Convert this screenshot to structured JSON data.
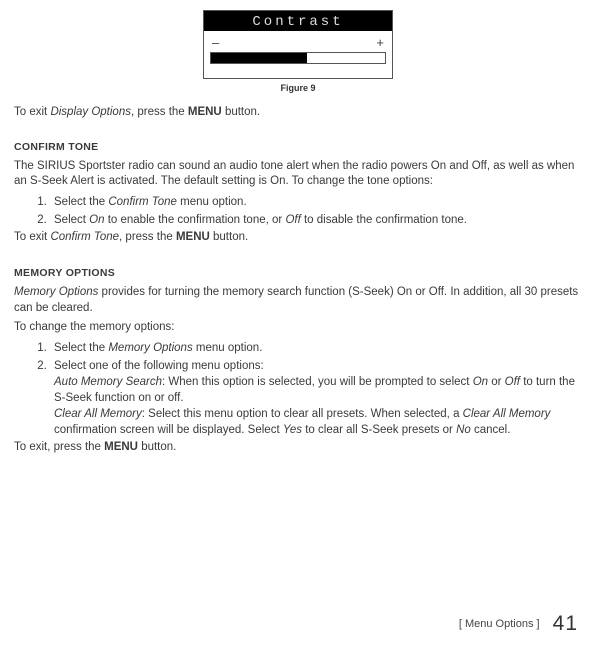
{
  "lcd": {
    "title": "Contrast",
    "minus": "–",
    "plus": "+"
  },
  "figure_caption": "Figure 9",
  "exit_display": {
    "pre": "To exit ",
    "italic": "Display Options",
    "mid": ", press the ",
    "bold": "MENU",
    "post": " button."
  },
  "confirm": {
    "heading": "CONFIRM TONE",
    "intro": "The SIRIUS Sportster radio can sound an audio tone alert when the radio powers On and Off, as well as when an S-Seek Alert is activated. The default setting is On. To change the tone options:",
    "step1": {
      "pre": "Select the ",
      "italic": "Confirm Tone",
      "post": " menu option."
    },
    "step2": {
      "pre": "Select ",
      "i1": "On",
      "mid": " to enable the confirmation tone, or ",
      "i2": "Off",
      "post": " to disable the confirmation tone."
    },
    "exit": {
      "pre": "To exit ",
      "italic": "Confirm Tone",
      "mid": ", press the ",
      "bold": "MENU",
      "post": " button."
    }
  },
  "memory": {
    "heading": "MEMORY OPTIONS",
    "intro": {
      "i": "Memory Options",
      "rest": " provides for turning the memory search function (S-Seek) On or Off. In addition, all 30 presets can be cleared."
    },
    "lead": "To change the memory options:",
    "step1": {
      "pre": "Select the ",
      "italic": "Memory Options",
      "post": " menu option."
    },
    "step2_lead": "Select one of the following menu options:",
    "step2_a": {
      "i1": "Auto Memory Search",
      "t1": ": When this option is selected, you will be prompted to select ",
      "i2": "On",
      "t2": " or ",
      "i3": "Off",
      "t3": " to turn the S-Seek function on or off."
    },
    "step2_b": {
      "i1": "Clear All Memory",
      "t1": ": Select this menu option to clear all presets. When selected, a ",
      "i2": "Clear All Memory",
      "t2": " confirmation screen will be displayed. Select ",
      "i3": "Yes",
      "t3": " to clear all S-Seek presets or ",
      "i4": "No",
      "t4": " cancel."
    },
    "exit": {
      "pre": "To exit, press the ",
      "bold": "MENU",
      "post": " button."
    }
  },
  "footer": {
    "section": "[ Menu Options ]",
    "page": "41"
  }
}
